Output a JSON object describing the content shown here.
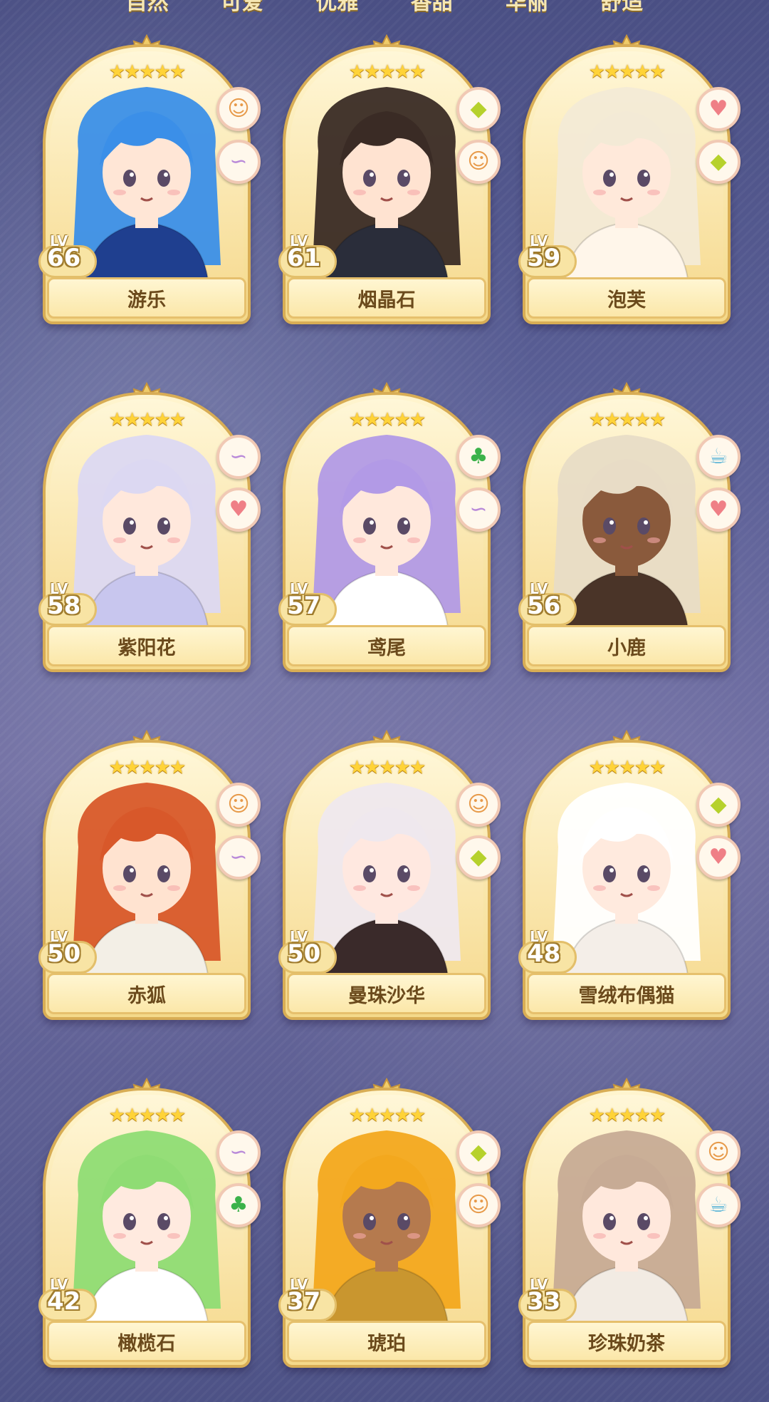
{
  "top_tabs": [
    "自然",
    "可爱",
    "优雅",
    "香甜",
    "华丽",
    "舒适"
  ],
  "cards": [
    {
      "name": "游乐",
      "level": "66",
      "stars": 5,
      "traits": [
        "face-icon",
        "swan-icon"
      ],
      "hair": "#3b8fe8",
      "skin": "#ffe6d6",
      "outfit": "#1f3f8f"
    },
    {
      "name": "烟晶石",
      "level": "61",
      "stars": 5,
      "traits": [
        "gem-icon",
        "face-icon"
      ],
      "hair": "#3a2b25",
      "skin": "#ffe3d1",
      "outfit": "#2a2d3a"
    },
    {
      "name": "泡芙",
      "level": "59",
      "stars": 5,
      "traits": [
        "heart-icon",
        "gem-icon"
      ],
      "hair": "#f3ead6",
      "skin": "#ffe9da",
      "outfit": "#fff6ea"
    },
    {
      "name": "紫阳花",
      "level": "58",
      "stars": 5,
      "traits": [
        "swan-icon",
        "heart-icon"
      ],
      "hair": "#dcd8f2",
      "skin": "#ffe8dc",
      "outfit": "#c8c6ee"
    },
    {
      "name": "鸢尾",
      "level": "57",
      "stars": 5,
      "traits": [
        "clover-icon",
        "swan-icon"
      ],
      "hair": "#b29ae6",
      "skin": "#ffe8dc",
      "outfit": "#ffffff"
    },
    {
      "name": "小鹿",
      "level": "56",
      "stars": 5,
      "traits": [
        "cup-icon",
        "heart-icon"
      ],
      "hair": "#e8dcc6",
      "skin": "#8a5a3c",
      "outfit": "#4a3428"
    },
    {
      "name": "赤狐",
      "level": "50",
      "stars": 5,
      "traits": [
        "face-icon",
        "swan-icon"
      ],
      "hair": "#d8582a",
      "skin": "#ffe3d0",
      "outfit": "#f3efe6"
    },
    {
      "name": "曼珠沙华",
      "level": "50",
      "stars": 5,
      "traits": [
        "face-icon",
        "gem-icon"
      ],
      "hair": "#efe8ee",
      "skin": "#ffe8e0",
      "outfit": "#3a2a2a"
    },
    {
      "name": "雪绒布偶猫",
      "level": "48",
      "stars": 5,
      "traits": [
        "gem-icon",
        "heart-icon"
      ],
      "hair": "#ffffff",
      "skin": "#ffeade",
      "outfit": "#f4eee8"
    },
    {
      "name": "橄榄石",
      "level": "42",
      "stars": 5,
      "traits": [
        "swan-icon",
        "clover-icon"
      ],
      "hair": "#8fdc74",
      "skin": "#ffeadf",
      "outfit": "#ffffff"
    },
    {
      "name": "琥珀",
      "level": "37",
      "stars": 5,
      "traits": [
        "gem-icon",
        "face-icon"
      ],
      "hair": "#f3a81e",
      "skin": "#b57a4e",
      "outfit": "#c9962f"
    },
    {
      "name": "珍珠奶茶",
      "level": "33",
      "stars": 5,
      "traits": [
        "face-icon",
        "cup-icon"
      ],
      "hair": "#c7ab95",
      "skin": "#ffe8dc",
      "outfit": "#f2ebe3"
    }
  ],
  "lv_label": "LV",
  "icons": {
    "heart-icon": "♥",
    "gem-icon": "◆",
    "swan-icon": "∽",
    "clover-icon": "♣",
    "face-icon": "☺",
    "cup-icon": "☕"
  },
  "icon_classes": {
    "heart-icon": "t-heart",
    "gem-icon": "t-gem",
    "swan-icon": "t-swan",
    "clover-icon": "t-clover",
    "face-icon": "t-face",
    "cup-icon": "t-cup"
  }
}
